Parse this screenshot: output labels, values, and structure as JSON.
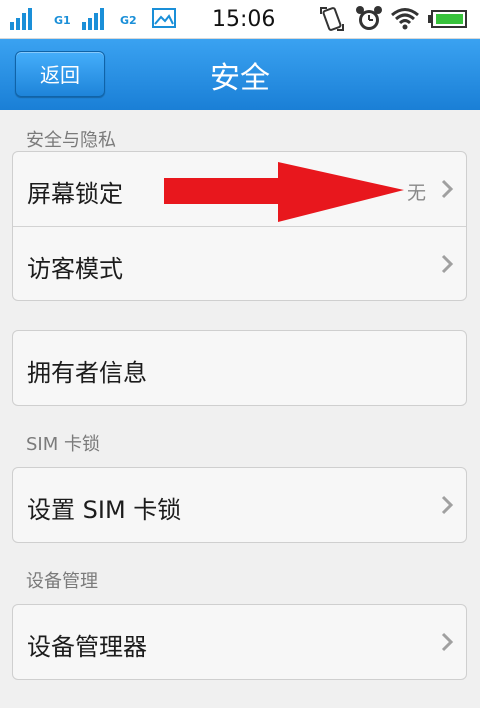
{
  "status_bar": {
    "sim1_label": "G1",
    "sim2_label": "G2",
    "time": "15:06",
    "icons": [
      "signal-icon",
      "signal-icon",
      "image-icon",
      "rotate-lock-icon",
      "alarm-icon",
      "wifi-icon",
      "battery-icon"
    ]
  },
  "header": {
    "back_label": "返回",
    "title": "安全"
  },
  "sections": [
    {
      "header": "安全与隐私",
      "rows": [
        {
          "label": "屏幕锁定",
          "value": "无"
        },
        {
          "label": "访客模式",
          "value": ""
        }
      ]
    },
    {
      "header": "",
      "rows": [
        {
          "label": "拥有者信息",
          "value": ""
        }
      ]
    },
    {
      "header": "SIM 卡锁",
      "rows": [
        {
          "label": "设置 SIM 卡锁",
          "value": ""
        }
      ]
    },
    {
      "header": "设备管理",
      "rows": [
        {
          "label": "设备管理器",
          "value": ""
        }
      ]
    }
  ],
  "colors": {
    "title_bar": "#1a7fd6",
    "background": "#f0f0f0",
    "annotation_arrow": "#e8171d"
  }
}
